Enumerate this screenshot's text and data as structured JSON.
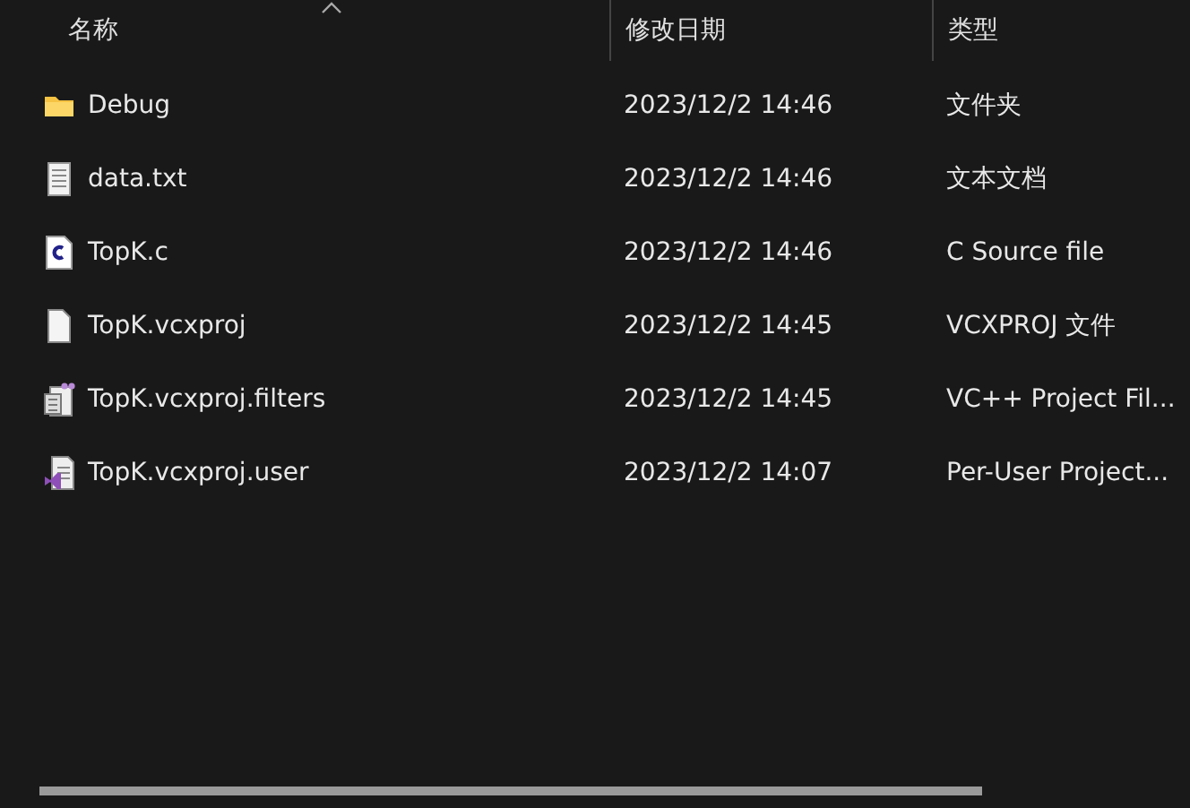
{
  "columns": [
    {
      "label": "名称",
      "sorted": true
    },
    {
      "label": "修改日期",
      "sorted": false
    },
    {
      "label": "类型",
      "sorted": false
    }
  ],
  "files": [
    {
      "kind": "folder",
      "name": "Debug",
      "modified": "2023/12/2 14:46",
      "type": "文件夹"
    },
    {
      "kind": "text",
      "name": "data.txt",
      "modified": "2023/12/2 14:46",
      "type": "文本文档"
    },
    {
      "kind": "csource",
      "name": "TopK.c",
      "modified": "2023/12/2 14:46",
      "type": "C Source file"
    },
    {
      "kind": "blank",
      "name": "TopK.vcxproj",
      "modified": "2023/12/2 14:45",
      "type": "VCXPROJ 文件"
    },
    {
      "kind": "filters",
      "name": "TopK.vcxproj.filters",
      "modified": "2023/12/2 14:45",
      "type": "VC++ Project Fil..."
    },
    {
      "kind": "vsuser",
      "name": "TopK.vcxproj.user",
      "modified": "2023/12/2 14:07",
      "type": "Per-User Project..."
    }
  ]
}
